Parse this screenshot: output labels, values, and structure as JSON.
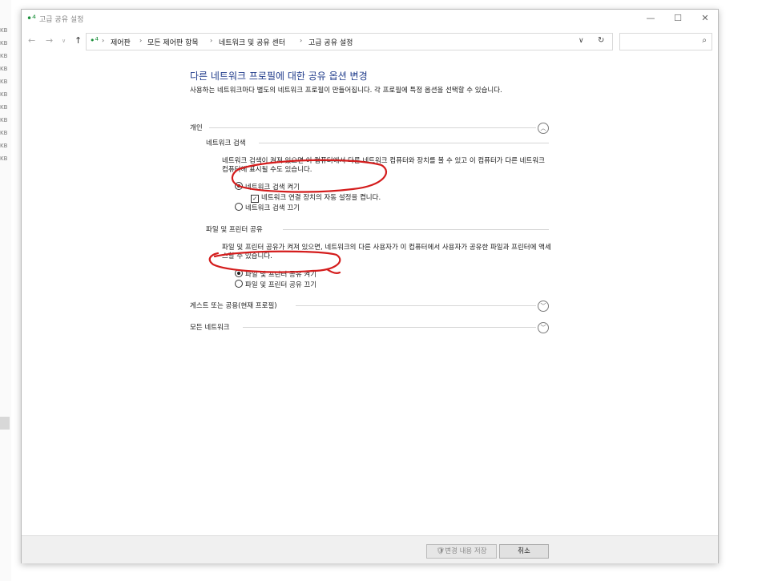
{
  "window": {
    "title": "고급 공유 설정",
    "controls": {
      "minimize": "—",
      "maximize": "☐",
      "close": "✕"
    }
  },
  "navigation": {
    "back": "←",
    "forward": "→",
    "recent": "∨",
    "up": "↑",
    "breadcrumbs": [
      "제어판",
      "모든 제어판 항목",
      "네트워크 및 공유 센터",
      "고급 공유 설정"
    ],
    "separator": "›",
    "dropdown": "∨",
    "refresh": "↻",
    "search_placeholder": "",
    "search_icon_glyph": "⌕"
  },
  "background": {
    "size_labels": [
      "KB",
      "KB",
      "KB",
      "KB",
      "KB",
      "KB",
      "KB",
      "KB",
      "KB",
      "KB",
      "KB"
    ]
  },
  "page": {
    "title": "다른 네트워크 프로필에 대한 공유 옵션 변경",
    "description": "사용하는 네트워크마다 별도의 네트워크 프로필이 만들어집니다. 각 프로필에 특정 옵션을 선택할 수 있습니다."
  },
  "sections": {
    "private": {
      "label": "개인",
      "chevron": "︿",
      "network_discovery": {
        "heading": "네트워크 검색",
        "description": "네트워크 검색이 켜져 있으면 이 컴퓨터에서 다른 네트워크 컴퓨터와 장치를 볼 수 있고 이 컴퓨터가 다른 네트워크 컴퓨터에 표시될 수도 있습니다.",
        "option_on": "네트워크 검색 켜기",
        "auto_setup": "네트워크 연결 장치의 자동 설정을 켭니다.",
        "option_off": "네트워크 검색 끄기",
        "check_glyph": "✓"
      },
      "file_printer_sharing": {
        "heading": "파일 및 프린터 공유",
        "description": "파일 및 프린터 공유가 켜져 있으면, 네트워크의 다른 사용자가 이 컴퓨터에서 사용자가 공유한 파일과 프린터에 액세스할 수 있습니다.",
        "option_on": "파일 및 프린터 공유 켜기",
        "option_off": "파일 및 프린터 공유 끄기"
      }
    },
    "guest_public": {
      "label": "게스트 또는 공용(현재 프로필)",
      "chevron": "﹀"
    },
    "all_networks": {
      "label": "모든 네트워크",
      "chevron": "﹀"
    }
  },
  "footer": {
    "save_label": "변경 내용 저장",
    "shield_glyph": "🛡",
    "cancel_label": "취소"
  },
  "colors": {
    "title_blue": "#1e3a8a",
    "annotation_red": "#d41c1c",
    "network_icon_green": "#1a8f3a"
  }
}
